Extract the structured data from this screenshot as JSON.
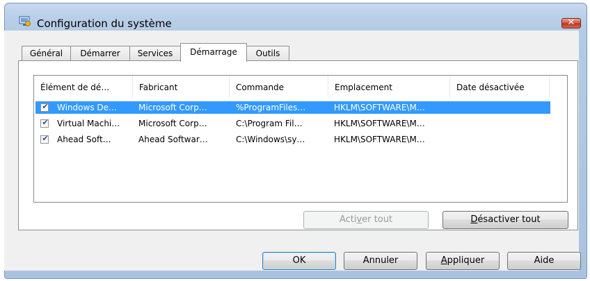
{
  "window": {
    "title": "Configuration du système"
  },
  "tabs": [
    {
      "label": "Général"
    },
    {
      "label": "Démarrer"
    },
    {
      "label": "Services"
    },
    {
      "label": "Démarrage"
    },
    {
      "label": "Outils"
    }
  ],
  "active_tab": "Démarrage",
  "list": {
    "columns": [
      "Élément de dé…",
      "Fabricant",
      "Commande",
      "Emplacement",
      "Date désactivée"
    ],
    "rows": [
      {
        "checked": true,
        "selected": true,
        "item": "Windows De…",
        "maker": "Microsoft Corp…",
        "command": "%ProgramFiles…",
        "location": "HKLM\\SOFTWARE\\M…",
        "date": ""
      },
      {
        "checked": true,
        "selected": false,
        "item": "Virtual Machi…",
        "maker": "Microsoft Corp…",
        "command": "C:\\Program Fil…",
        "location": "HKLM\\SOFTWARE\\M…",
        "date": ""
      },
      {
        "checked": true,
        "selected": false,
        "item": "Ahead Soft…",
        "maker": "Ahead Softwar…",
        "command": "C:\\Windows\\sy…",
        "location": "HKLM\\SOFTWARE\\M…",
        "date": ""
      }
    ]
  },
  "buttons": {
    "enable_all": {
      "before": "Acti",
      "mnemonic": "v",
      "after": "er tout"
    },
    "disable_all": {
      "before": "",
      "mnemonic": "D",
      "after": "ésactiver tout"
    },
    "ok": "OK",
    "cancel": "Annuler",
    "apply": {
      "before": "",
      "mnemonic": "A",
      "after": "ppliquer"
    },
    "help": "Aide"
  },
  "colors": {
    "selection": "#3399ff",
    "close_button": "#c9452c",
    "frame": "#b9cfe9"
  },
  "icons": {
    "title": "system-config-icon",
    "close": "close-icon",
    "check": "checkbox-checked-icon"
  }
}
